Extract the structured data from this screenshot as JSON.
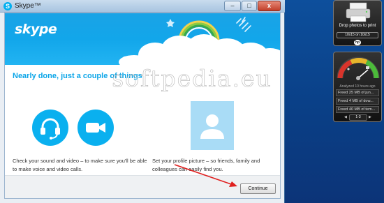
{
  "window": {
    "title": "Skype™",
    "minimize_glyph": "–",
    "maximize_glyph": "□",
    "close_glyph": "x"
  },
  "brand": {
    "logo_text": "skype",
    "accent_color": "#00aff0"
  },
  "main": {
    "heading": "Nearly done, just a couple of things",
    "sound_video_text": "Check your sound and video – to make sure you'll be able to make voice and video calls.",
    "profile_picture_text": "Set your profile picture – so friends, family and colleagues can easily find you.",
    "icons": [
      "headset-icon",
      "video-camera-icon",
      "profile-avatar-icon"
    ]
  },
  "footer": {
    "continue_label": "Continue"
  },
  "watermark": {
    "text": "softpedia.eu"
  },
  "gadgets": {
    "print": {
      "caption": "Drop photos to print",
      "size_option": "10x15 on 10x15",
      "brand": "hp"
    },
    "cleaner": {
      "analyzed_text": "Analyzed 10 hours ago",
      "items": [
        "Freed 25 MB of jun...",
        "Freed 4 MB of dow...",
        "Freed 40 MB of tem..."
      ],
      "page_indicator": "1-3"
    }
  }
}
